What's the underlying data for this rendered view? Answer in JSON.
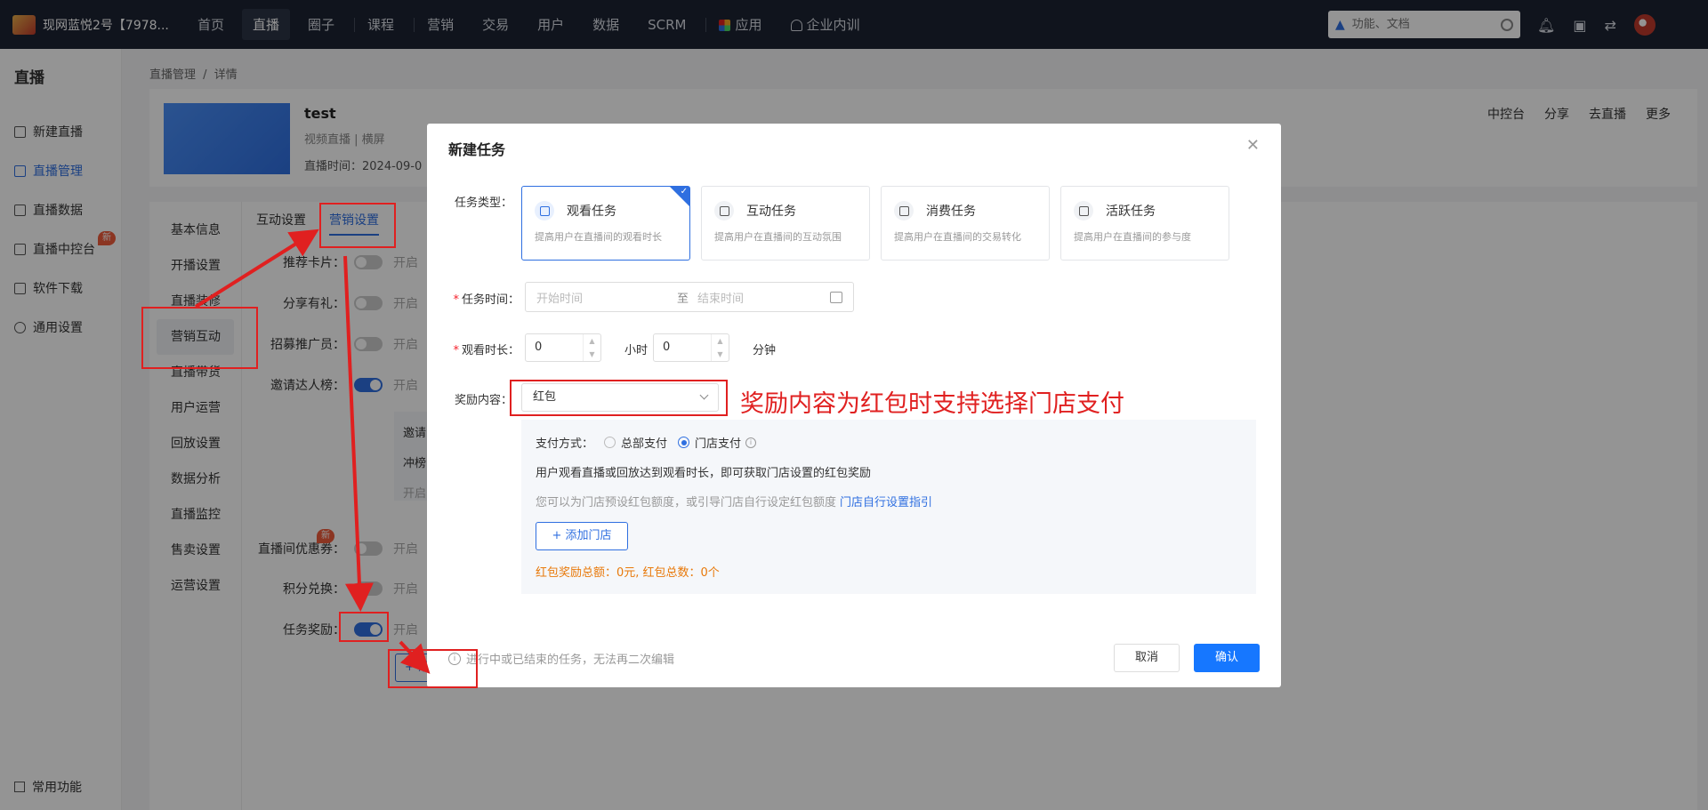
{
  "topbar": {
    "brand": "现网蓝悦2号【7978...",
    "nav": [
      "首页",
      "直播",
      "圈子",
      "课程",
      "营销",
      "交易",
      "用户",
      "数据",
      "SCRM",
      "应用",
      "企业内训"
    ],
    "search_placeholder": "功能、文档"
  },
  "sidebar": {
    "title": "直播",
    "items": [
      "新建直播",
      "直播管理",
      "直播数据",
      "直播中控台",
      "软件下载",
      "通用设置"
    ],
    "new_badge": "新",
    "bottom": "常用功能"
  },
  "breadcrumb": {
    "parent": "直播管理",
    "sep": "/",
    "current": "详情"
  },
  "live": {
    "title": "test",
    "meta": "视频直播  |  横屏",
    "time_label": "直播时间：2024-09-0",
    "actions": [
      "中控台",
      "分享",
      "去直播",
      "更多"
    ]
  },
  "subnav": [
    "基本信息",
    "开播设置",
    "直播装修",
    "营销互动",
    "直播带货",
    "用户运营",
    "回放设置",
    "数据分析",
    "直播监控",
    "售卖设置",
    "运营设置"
  ],
  "tabs": [
    "互动设置",
    "营销设置"
  ],
  "settings": [
    {
      "label": "推荐卡片：",
      "on": false,
      "hint": "开启"
    },
    {
      "label": "分享有礼：",
      "on": false,
      "hint": "开启"
    },
    {
      "label": "招募推广员：",
      "on": false,
      "hint": "开启"
    },
    {
      "label": "邀请达人榜：",
      "on": true,
      "hint": "开启"
    },
    {
      "label": "直播间优惠券：",
      "on": false,
      "hint": "开启"
    },
    {
      "label": "积分兑换：",
      "on": false,
      "hint": "开启"
    },
    {
      "label": "任务奖励：",
      "on": true,
      "hint": "开启"
    }
  ],
  "partial_texts": {
    "invite": "邀请",
    "rush": "冲榜",
    "open": "开启",
    "add": "+ 添"
  },
  "modal": {
    "title": "新建任务",
    "task_type_label": "任务类型：",
    "task_types": [
      {
        "name": "观看任务",
        "desc": "提高用户在直播间的观看时长"
      },
      {
        "name": "互动任务",
        "desc": "提高用户在直播间的互动氛围"
      },
      {
        "name": "消费任务",
        "desc": "提高用户在直播间的交易转化"
      },
      {
        "name": "活跃任务",
        "desc": "提高用户在直播间的参与度"
      }
    ],
    "task_time_label": "任务时间：",
    "start_placeholder": "开始时间",
    "range_sep": "至",
    "end_placeholder": "结束时间",
    "watch_label": "观看时长：",
    "hours_value": "0",
    "hours_unit": "小时",
    "minutes_value": "0",
    "minutes_unit": "分钟",
    "reward_label": "奖励内容：",
    "reward_value": "红包",
    "pay_label": "支付方式：",
    "pay_options": [
      "总部支付",
      "门店支付"
    ],
    "desc1": "用户观看直播或回放达到观看时长，即可获取门店设置的红包奖励",
    "desc2": "您可以为门店预设红包额度，或引导门店自行设定红包额度",
    "desc2_link": "门店自行设置指引",
    "add_store": "+ 添加门店",
    "totals": "红包奖励总额：0元, 红包总数：0个",
    "footer_note": "进行中或已结束的任务，无法再二次编辑",
    "cancel": "取消",
    "confirm": "确认"
  },
  "annotation": "奖励内容为红包时支持选择门店支付",
  "colors": {
    "primary": "#1677ff",
    "annotation_red": "#e02020",
    "topbar": "#1d2433"
  }
}
